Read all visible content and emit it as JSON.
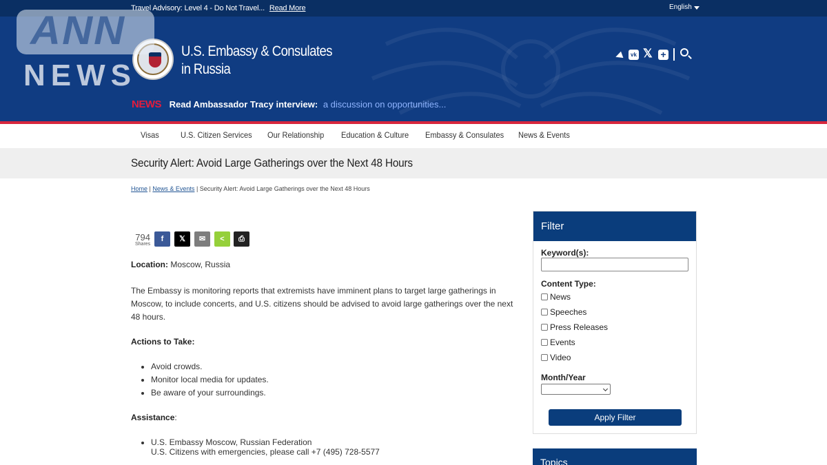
{
  "topbar": {
    "advisory": "Travel Advisory: Level 4 - Do Not Travel...",
    "advisory_link": "Read More",
    "language": "English"
  },
  "header": {
    "title_line1": "U.S. Embassy & Consulates",
    "title_line2": "in Russia",
    "social_icons": [
      "telegram-icon",
      "vk-icon",
      "x-icon",
      "plus-icon",
      "search-icon"
    ],
    "vk_glyph": "vk",
    "x_glyph": "𝕏",
    "plus_glyph": "+"
  },
  "ticker": {
    "tag": "NEWS",
    "lead": "Read Ambassador Tracy interview:",
    "link": "a discussion on opportunities..."
  },
  "nav": {
    "items": [
      "Visas",
      "U.S. Citizen Services",
      "Our Relationship",
      "Education & Culture",
      "Embassy & Consulates",
      "News & Events"
    ]
  },
  "page": {
    "title": "Security Alert: Avoid Large Gatherings over the Next 48 Hours",
    "breadcrumb": {
      "home": "Home",
      "separator": "|",
      "section": "News & Events",
      "current": "Security Alert: Avoid Large Gatherings over the Next 48 Hours"
    }
  },
  "share": {
    "count": "794",
    "count_label": "Shares",
    "buttons": [
      {
        "name": "facebook",
        "glyph": "f",
        "color": "#3b5998"
      },
      {
        "name": "x",
        "glyph": "𝕏",
        "color": "#000000"
      },
      {
        "name": "email",
        "glyph": "✉",
        "color": "#7d7d7d"
      },
      {
        "name": "sharethis",
        "glyph": "<",
        "color": "#95d03a"
      },
      {
        "name": "print",
        "glyph": "⎙",
        "color": "#222222"
      }
    ]
  },
  "article": {
    "location_label": "Location:",
    "location_value": "Moscow, Russia",
    "paragraph_lines": [
      "The Embassy is monitoring reports that extremists have imminent plans to target large gatherings in",
      "Moscow, to include concerts, and U.S. citizens should be advised to avoid large gatherings over the next",
      "48 hours."
    ],
    "actions_heading": "Actions to Take:",
    "actions": [
      "Avoid crowds.",
      "Monitor local media for updates.",
      "Be aware of your surroundings."
    ],
    "assistance_heading": "Assistance",
    "assistance_colon": ":",
    "assistance_lines": [
      "U.S. Embassy Moscow, Russian Federation",
      "U.S. Citizens with emergencies, please call +7 (495) 728-5577"
    ]
  },
  "filter": {
    "heading": "Filter",
    "keyword_label": "Keyword(s):",
    "keyword_value": "",
    "content_type_label": "Content Type:",
    "content_types": [
      "News",
      "Speeches",
      "Press Releases",
      "Events",
      "Video"
    ],
    "month_year_label": "Month/Year",
    "month_year_value": "",
    "apply_label": "Apply Filter"
  },
  "topics": {
    "heading": "Topics"
  },
  "watermark": {
    "line1": "ANN",
    "line2": "NEWS"
  },
  "colors": {
    "topbar": "#0a2f63",
    "header": "#103c82",
    "accent_red": "#d7263d",
    "filter_blue": "#0a3d7c"
  }
}
